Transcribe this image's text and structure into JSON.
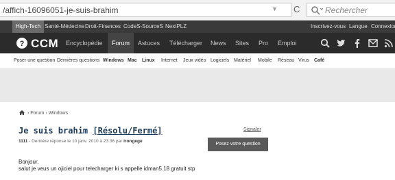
{
  "browser": {
    "url": "/affich-16096051-je-suis-brahim",
    "search_placeholder": "Rechercher"
  },
  "topbar": {
    "items": [
      "High-Tech",
      "Santé-Médecine",
      "Droit-Finances",
      "CodeS-SourceS",
      "NextPLZ"
    ],
    "right": [
      "Inscrivez-vous",
      "Langue",
      "Connexion"
    ]
  },
  "mainnav": {
    "logo": "CCM",
    "items": [
      "Encyclopédie",
      "Forum",
      "Astuces",
      "Télécharger",
      "News",
      "Sites",
      "Pro",
      "Emploi"
    ],
    "icons": [
      "search-icon",
      "twitter-icon",
      "facebook-icon",
      "mail-icon",
      "rss-icon"
    ]
  },
  "subnav": {
    "items": [
      "Poser une question",
      "Dernières questions",
      "Windows",
      "Mac",
      "Linux",
      "Internet",
      "Jeux vidéo",
      "Logiciels",
      "Matériel",
      "Mobile",
      "Réseau",
      "Virus",
      "Café"
    ]
  },
  "post": {
    "breadcrumb": [
      "Forum",
      "Windows"
    ],
    "title": "Je suis brahim",
    "status": "[Résolu/Fermé]",
    "report": "Signaler",
    "meta_count": "1111",
    "meta_text": "- Dernière réponse le 10 janv. 2010 à 23:36 par",
    "author": "irongege",
    "ask_button": "Posez votre question",
    "greeting": "Bonjour,",
    "body": "salut je veus un ojiciel pour telecharger ki s appelle idman5.18 gratuit stp"
  }
}
